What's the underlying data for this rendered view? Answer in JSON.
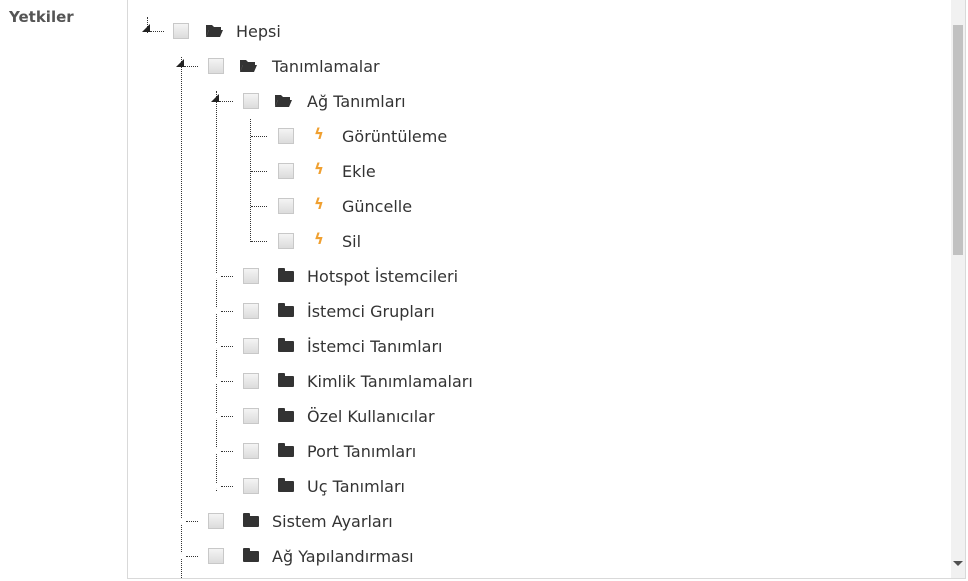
{
  "form": {
    "label": "Yetkiler"
  },
  "tree": {
    "root": {
      "label": "Hepsi",
      "icon": "folder-open-icon"
    },
    "tanimlamalar": {
      "label": "Tanımlamalar",
      "icon": "folder-open-icon"
    },
    "ag_tanimlari": {
      "label": "Ağ Tanımları",
      "icon": "folder-open-icon"
    },
    "permissions": [
      {
        "label": "Görüntüleme",
        "icon": "bolt-icon"
      },
      {
        "label": "Ekle",
        "icon": "bolt-icon"
      },
      {
        "label": "Güncelle",
        "icon": "bolt-icon"
      },
      {
        "label": "Sil",
        "icon": "bolt-icon"
      }
    ],
    "subfolders": [
      {
        "label": "Hotspot İstemcileri",
        "icon": "folder-icon"
      },
      {
        "label": "İstemci Grupları",
        "icon": "folder-icon"
      },
      {
        "label": "İstemci Tanımları",
        "icon": "folder-icon"
      },
      {
        "label": "Kimlik Tanımlamaları",
        "icon": "folder-icon"
      },
      {
        "label": "Özel Kullanıcılar",
        "icon": "folder-icon"
      },
      {
        "label": "Port Tanımları",
        "icon": "folder-icon"
      },
      {
        "label": "Uç Tanımları",
        "icon": "folder-icon"
      }
    ],
    "top_folders": [
      {
        "label": "Sistem Ayarları",
        "icon": "folder-icon"
      },
      {
        "label": "Ağ Yapılandırması",
        "icon": "folder-icon"
      }
    ]
  },
  "colors": {
    "bolt": "#f0a030",
    "folder": "#333333",
    "checkbox_border": "#c8c8c8"
  }
}
